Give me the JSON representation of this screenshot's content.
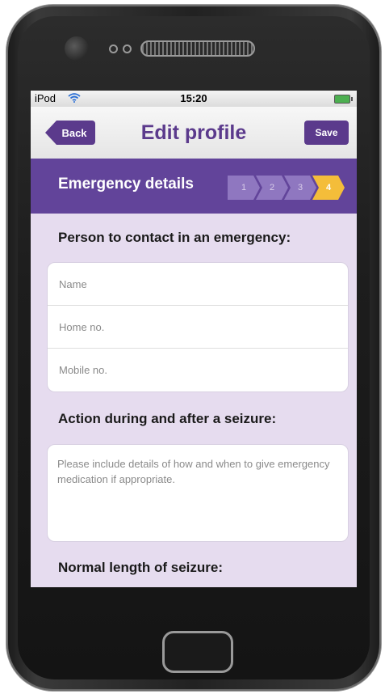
{
  "status_bar": {
    "carrier": "iPod",
    "time": "15:20"
  },
  "nav": {
    "back_label": "Back",
    "title": "Edit profile",
    "save_label": "Save"
  },
  "section": {
    "title": "Emergency details",
    "steps": [
      "1",
      "2",
      "3",
      "4"
    ],
    "active_step": "4"
  },
  "contact": {
    "heading": "Person to contact in an emergency:",
    "name_placeholder": "Name",
    "home_placeholder": "Home no.",
    "mobile_placeholder": "Mobile no."
  },
  "action": {
    "heading": "Action during and after a seizure:",
    "placeholder": "Please include details of how and when to give emergency medication if appropriate."
  },
  "length": {
    "heading": "Normal length of seizure:"
  },
  "colors": {
    "brand_purple": "#5b3a8c",
    "header_purple": "#62449a",
    "active_step": "#f4bd3a",
    "screen_bg": "#e6dcef"
  }
}
